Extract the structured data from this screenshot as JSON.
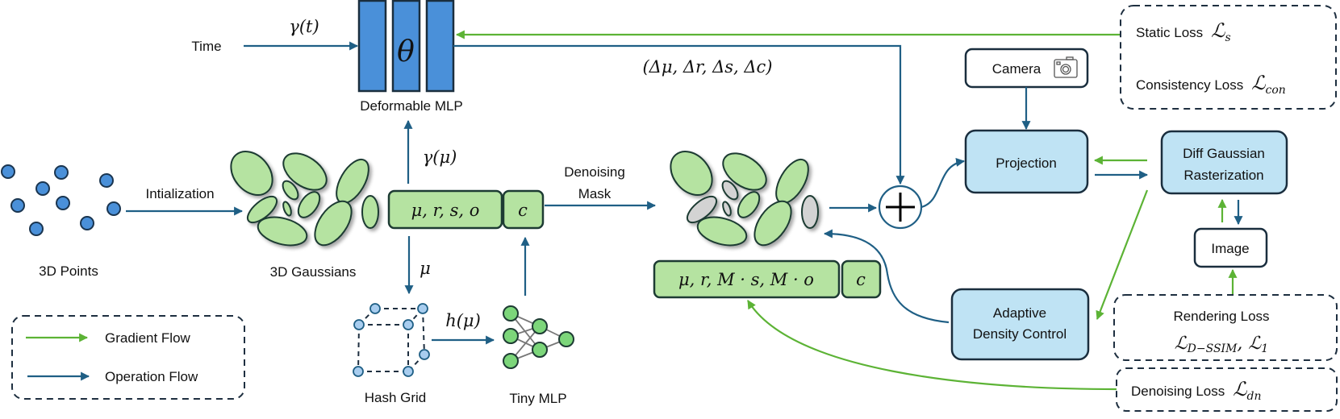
{
  "colors": {
    "operation": "#1f5f85",
    "gradient": "#5cb335",
    "mlp": "#4a90d9",
    "gaussian": "#b5e3a1",
    "masked_gaussian": "#d3d3d3",
    "process_box": "#bfe3f4"
  },
  "inputs": {
    "time": "Time",
    "gamma_t": "γ(t)",
    "points": "3D Points",
    "init": "Intialization",
    "gaussians": "3D Gaussians"
  },
  "mlp": {
    "theta": "θ",
    "label": "Deformable MLP",
    "deltas": "(Δμ, Δr, Δs, Δc)"
  },
  "attrs": {
    "main": "μ, r, s, o",
    "color": "c",
    "gamma_mu": "γ(μ)",
    "mu": "μ",
    "h_mu": "h(μ)"
  },
  "denoise": {
    "line1": "Denoising",
    "line2": "Mask",
    "masked": "μ, r, M · s, M · o",
    "color": "c"
  },
  "hash": {
    "label": "Hash Grid"
  },
  "tiny": {
    "label": "Tiny MLP"
  },
  "plus": "+",
  "camera": {
    "label": "Camera",
    "icon": "camera-icon"
  },
  "projection": "Projection",
  "raster": {
    "line1": "Diff Gaussian",
    "line2": "Rasterization"
  },
  "image": "Image",
  "adc": {
    "line1": "Adaptive",
    "line2": "Density Control"
  },
  "losses": {
    "static_label": "Static Loss",
    "static_sym": "ℒ",
    "static_sub": "s",
    "cons_label": "Consistency Loss",
    "cons_sym": "ℒ",
    "cons_sub": "con",
    "render_label": "Rendering Loss",
    "render_sym1": "ℒ",
    "render_sub1": "D−SSIM",
    "render_sep": ", ",
    "render_sym2": "ℒ",
    "render_sub2": "1",
    "dn_label": "Denoising Loss",
    "dn_sym": "ℒ",
    "dn_sub": "dn"
  },
  "legend": {
    "gradient": "Gradient Flow",
    "operation": "Operation Flow"
  }
}
